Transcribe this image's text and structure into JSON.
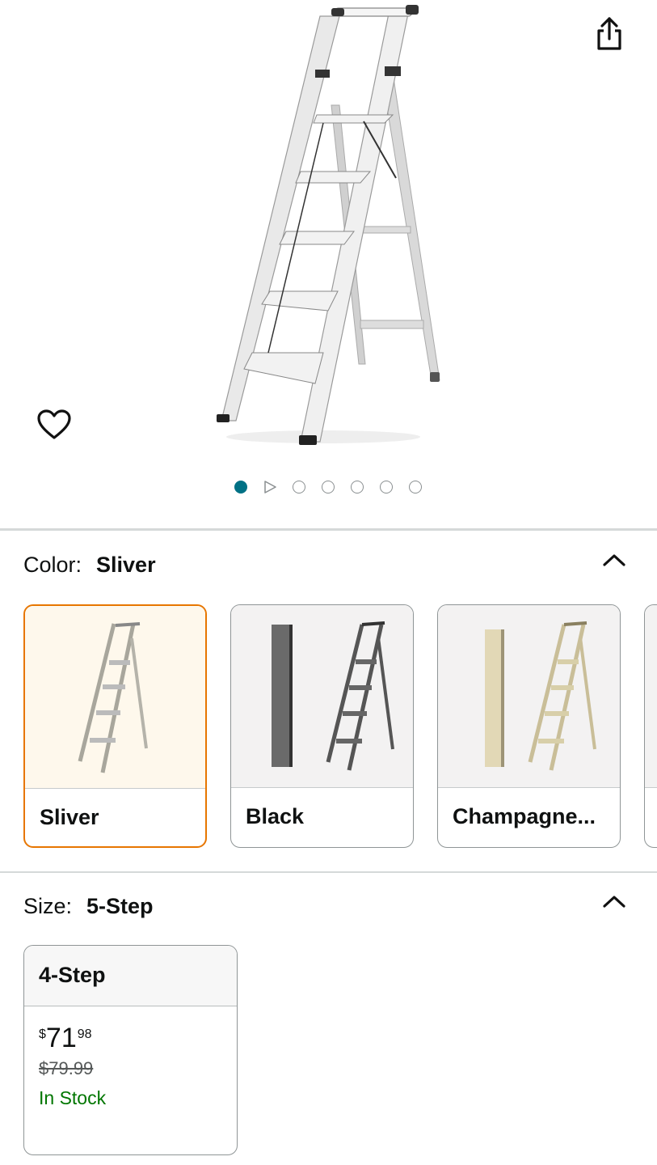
{
  "hero": {
    "share_icon": "share-icon",
    "wishlist_icon": "heart-outline-icon",
    "carousel": {
      "total": 7,
      "active_index": 0,
      "video_index": 1
    }
  },
  "color": {
    "label": "Color:",
    "selected": "Sliver",
    "options": [
      {
        "name": "Sliver",
        "selected": true,
        "ladder_color": "#e6e6e0"
      },
      {
        "name": "Black",
        "selected": false,
        "ladder_color": "#5a5a5a"
      },
      {
        "name": "Champagne...",
        "selected": false,
        "ladder_color": "#d9cfa8"
      }
    ]
  },
  "size": {
    "label": "Size:",
    "selected": "5-Step",
    "options": [
      {
        "name": "4-Step",
        "currency": "$",
        "price_whole": "71",
        "price_fraction": "98",
        "list_price": "$79.99",
        "availability": "In Stock"
      }
    ]
  },
  "colors": {
    "accent_selected": "#e77600",
    "carousel_active": "#007185",
    "in_stock": "#007600"
  }
}
